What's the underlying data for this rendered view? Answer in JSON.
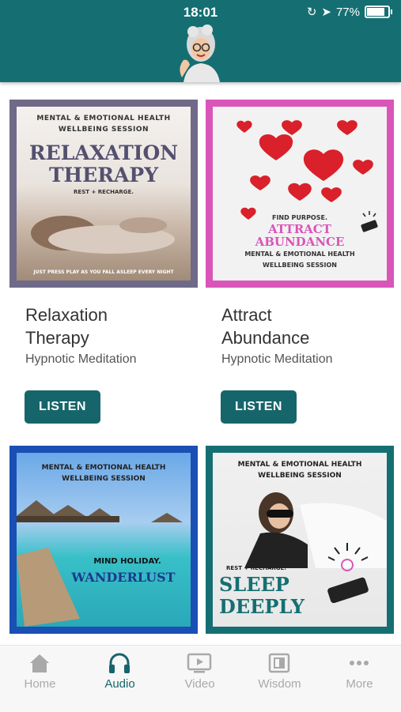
{
  "status": {
    "time": "18:01",
    "battery": "77%"
  },
  "cards": [
    {
      "art_top": "MENTAL & EMOTIONAL HEALTH",
      "art_top2": "WELLBEING SESSION",
      "art_title1": "RELAXATION",
      "art_title2": "THERAPY",
      "art_tag": "REST + RECHARGE.",
      "art_bottom": "JUST PRESS PLAY AS YOU FALL ASLEEP EVERY NIGHT",
      "title_line1": "Relaxation",
      "title_line2": "Therapy",
      "subtitle": "Hypnotic Meditation",
      "button": "LISTEN"
    },
    {
      "art_tag": "FIND PURPOSE.",
      "art_title1": "ATTRACT",
      "art_title2": "ABUNDANCE",
      "art_top": "MENTAL & EMOTIONAL HEALTH",
      "art_top2": "WELLBEING SESSION",
      "title_line1": "Attract",
      "title_line2": "Abundance",
      "subtitle": "Hypnotic Meditation",
      "button": "LISTEN"
    },
    {
      "art_top": "MENTAL & EMOTIONAL HEALTH",
      "art_top2": "WELLBEING SESSION",
      "art_tag": "MIND HOLIDAY.",
      "art_title1": "WANDERLUST"
    },
    {
      "art_top": "MENTAL & EMOTIONAL HEALTH",
      "art_top2": "WELLBEING SESSION",
      "art_tag": "REST + RECHARGE.",
      "art_title1": "SLEEP",
      "art_title2": "DEEPLY"
    }
  ],
  "tabs": [
    {
      "label": "Home",
      "icon": "home-icon"
    },
    {
      "label": "Audio",
      "icon": "headphones-icon",
      "active": true
    },
    {
      "label": "Video",
      "icon": "video-icon"
    },
    {
      "label": "Wisdom",
      "icon": "wisdom-icon"
    },
    {
      "label": "More",
      "icon": "more-icon"
    }
  ],
  "colors": {
    "header": "#156f72",
    "accent": "#16656b",
    "inactive": "#a9a9a9"
  }
}
